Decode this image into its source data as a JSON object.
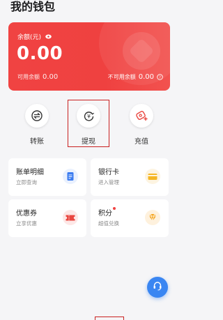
{
  "page": {
    "title": "我的钱包"
  },
  "balance": {
    "label": "余额(元)",
    "amount": "0.00",
    "available_label": "可用余额",
    "available_value": "0.00",
    "unavailable_label": "不可用余额",
    "unavailable_value": "0.00",
    "card_color": "#ef4140"
  },
  "quick_actions": [
    {
      "label": "转账",
      "icon": "transfer-icon"
    },
    {
      "label": "提现",
      "icon": "withdraw-icon"
    },
    {
      "label": "充值",
      "icon": "recharge-icon"
    }
  ],
  "tiles": [
    {
      "title": "账单明细",
      "sub": "立即查询",
      "icon": "bill-icon",
      "color": "#3a7bf0"
    },
    {
      "title": "银行卡",
      "sub": "进入管理",
      "icon": "bank-card-icon",
      "color": "#f5b623"
    },
    {
      "title": "优惠券",
      "sub": "立享优惠",
      "icon": "coupon-icon",
      "color": "#e9463f"
    },
    {
      "title": "积分",
      "sub": "超值兑换",
      "icon": "diamond-icon",
      "color": "#f5a623"
    }
  ],
  "support": {
    "icon": "customer-service-icon",
    "color": "#3a86f2"
  }
}
